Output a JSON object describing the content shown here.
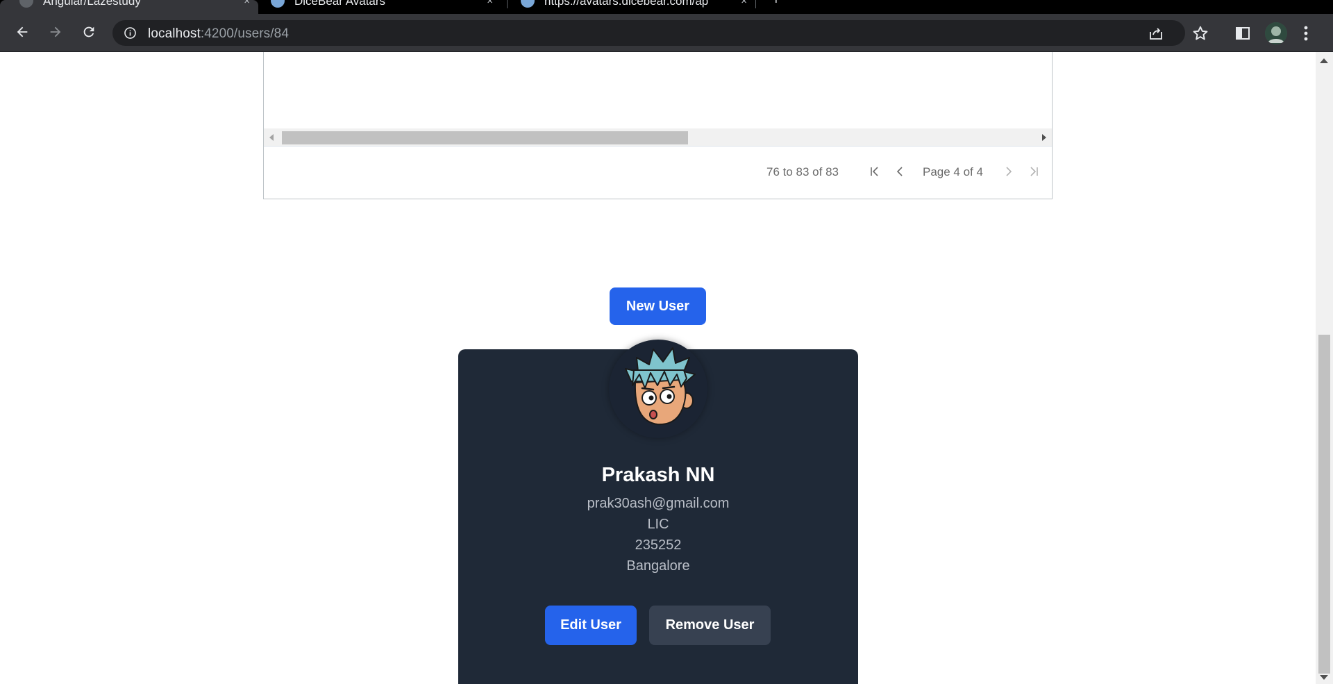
{
  "browser": {
    "tabs": [
      {
        "label": "Angular/Lazestudy",
        "active": true
      },
      {
        "label": "DiceBear Avatars",
        "active": false
      },
      {
        "label": "https://avatars.dicebear.com/ap",
        "active": false
      }
    ],
    "new_tab_label": "+",
    "tab_close_glyph": "×",
    "url_host": "localhost",
    "url_path": ":4200/users/84",
    "icons": {
      "back": "back-arrow-icon",
      "forward": "forward-arrow-icon",
      "reload": "reload-icon",
      "site_info": "info-icon",
      "share": "share-icon",
      "bookmark": "star-icon",
      "side_panel": "side-panel-icon",
      "menu": "kebab-menu-icon"
    }
  },
  "grid": {
    "summary": "76 to 83 of 83",
    "page_text": "Page 4 of 4",
    "horizontal_scroll_position": 0.42
  },
  "actions": {
    "new_user_label": "New User"
  },
  "user": {
    "name": "Prakash NN",
    "email": "prak30ash@gmail.com",
    "company": "LIC",
    "code": "235252",
    "city": "Bangalore",
    "edit_label": "Edit User",
    "remove_label": "Remove User"
  },
  "colors": {
    "primary": "#2563eb",
    "card_bg": "#1f2937",
    "secondary_btn": "#374151"
  }
}
